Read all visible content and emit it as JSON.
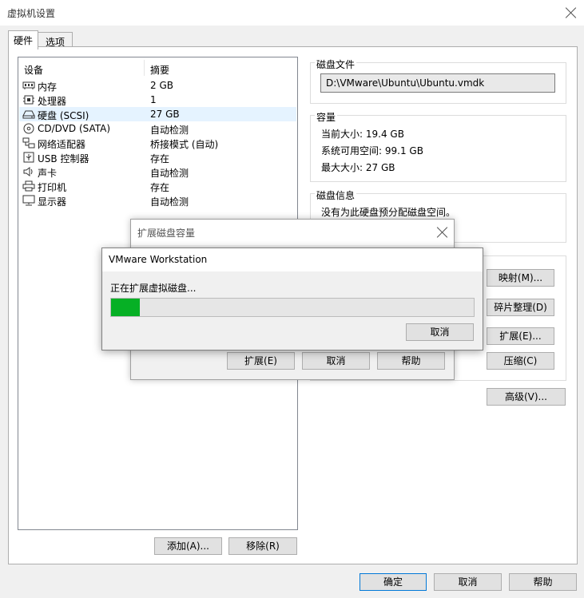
{
  "window": {
    "title": "虚拟机设置"
  },
  "tabs": [
    {
      "label": "硬件",
      "active": true
    },
    {
      "label": "选项",
      "active": false
    }
  ],
  "device_list": {
    "columns": [
      "设备",
      "摘要"
    ],
    "rows": [
      {
        "icon": "memory-icon",
        "name": "内存",
        "summary": "2 GB"
      },
      {
        "icon": "processor-icon",
        "name": "处理器",
        "summary": "1"
      },
      {
        "icon": "hard-disk-icon",
        "name": "硬盘 (SCSI)",
        "summary": "27 GB",
        "selected": true
      },
      {
        "icon": "cd-dvd-icon",
        "name": "CD/DVD (SATA)",
        "summary": "自动检测"
      },
      {
        "icon": "network-adapter-icon",
        "name": "网络适配器",
        "summary": "桥接模式 (自动)"
      },
      {
        "icon": "usb-icon",
        "name": "USB 控制器",
        "summary": "存在"
      },
      {
        "icon": "sound-icon",
        "name": "声卡",
        "summary": "自动检测"
      },
      {
        "icon": "printer-icon",
        "name": "打印机",
        "summary": "存在"
      },
      {
        "icon": "display-icon",
        "name": "显示器",
        "summary": "自动检测"
      }
    ],
    "add_button": "添加(A)...",
    "remove_button": "移除(R)"
  },
  "disk_file": {
    "title": "磁盘文件",
    "path": "D:\\VMware\\Ubuntu\\Ubuntu.vmdk"
  },
  "capacity": {
    "title": "容量",
    "current_size": "当前大小: 19.4 GB",
    "free_space": "系统可用空间: 99.1 GB",
    "max_size": "最大大小: 27 GB"
  },
  "disk_info": {
    "title": "磁盘信息",
    "text": "没有为此硬盘预分配磁盘空间。"
  },
  "utilities": {
    "map_button": "映射(M)...",
    "defrag_button": "碎片整理(D)",
    "expand_button": "扩展(E)...",
    "compact_button": "压缩(C)"
  },
  "advanced_button": "高级(V)...",
  "footer": {
    "ok": "确定",
    "cancel": "取消",
    "help": "帮助"
  },
  "expand_dialog": {
    "title": "扩展磁盘容量",
    "expand_button": "扩展(E)",
    "cancel_button": "取消",
    "help_button": "帮助"
  },
  "progress_dialog": {
    "title": "VMware Workstation",
    "message": "正在扩展虚拟磁盘...",
    "progress_percent": 8,
    "cancel_button": "取消"
  },
  "colors": {
    "progress": "#06b025",
    "selection": "#e5f3ff",
    "focus_border": "#0078d7"
  }
}
